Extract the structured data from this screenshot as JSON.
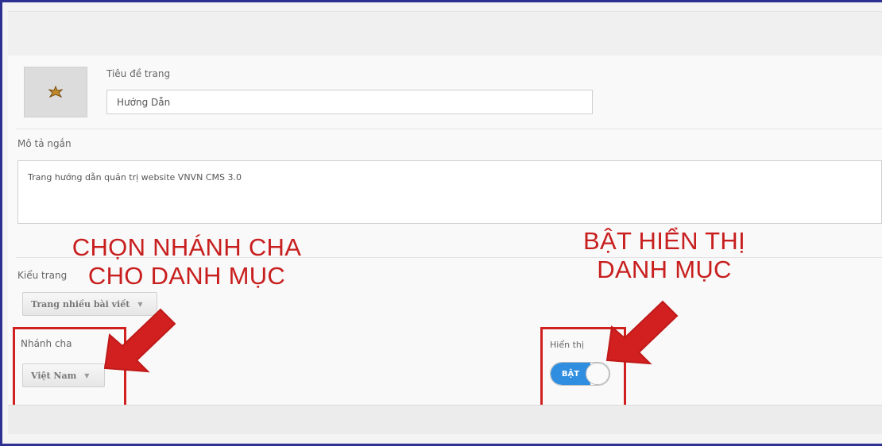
{
  "form": {
    "page_title_label": "Tiêu đề trang",
    "page_title_value": "Hướng Dẫn",
    "short_desc_label": "Mô tả ngắn",
    "short_desc_value": "Trang hướng dẫn quản trị website VNVN CMS 3.0",
    "page_type_label": "Kiểu trang",
    "page_type_value": "Trang nhiều bài viết",
    "parent_label": "Nhánh cha",
    "parent_value": "Việt Nam",
    "display_label": "Hiển thị",
    "display_toggle_text": "BẬT",
    "display_on": true
  },
  "annotations": {
    "left_line1": "CHỌN NHÁNH CHA",
    "left_line2": "CHO DANH MỤC",
    "right_line1": "BẬT HIỂN THỊ",
    "right_line2": "DANH MỤC"
  },
  "colors": {
    "annotation_red": "#c81e1e",
    "toggle_blue": "#2f8ee0",
    "frame_blue": "#2e3192"
  },
  "icons": {
    "thumbnail": "logo-thumbnail-icon",
    "dropdown": "caret-down-icon"
  }
}
